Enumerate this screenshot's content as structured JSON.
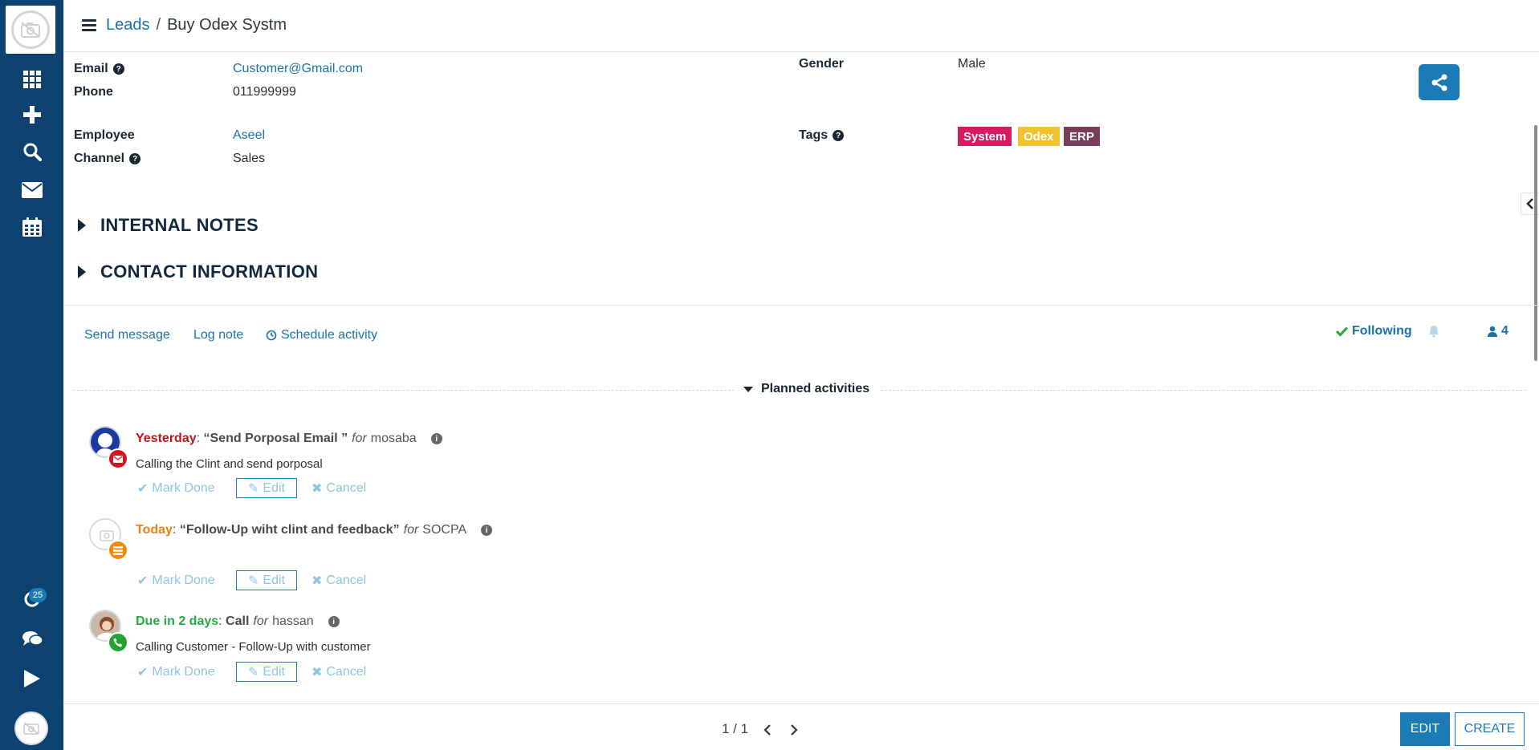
{
  "breadcrumb": {
    "parent": "Leads",
    "separator": "/",
    "current": "Buy Odex Systm"
  },
  "sidebar": {
    "items": [
      {
        "icon": "apps-grid-icon"
      },
      {
        "icon": "plus-icon"
      },
      {
        "icon": "search-icon"
      },
      {
        "icon": "mail-icon"
      },
      {
        "icon": "calendar-icon"
      },
      {
        "icon": "refresh-icon"
      },
      {
        "icon": "chat-icon"
      },
      {
        "icon": "play-icon"
      }
    ],
    "badge_count": "25"
  },
  "fields": {
    "email_label": "Email",
    "email_value": "Customer@Gmail.com",
    "phone_label": "Phone",
    "phone_value": "011999999",
    "employee_label": "Employee",
    "employee_value": "Aseel",
    "channel_label": "Channel",
    "channel_value": "Sales",
    "gender_label": "Gender",
    "gender_value": "Male",
    "tags_label": "Tags",
    "help_glyph": "?"
  },
  "tags": [
    {
      "label": "System",
      "color": "#d81b60"
    },
    {
      "label": "Odex",
      "color": "#f2c230"
    },
    {
      "label": "ERP",
      "color": "#7a3e5a"
    }
  ],
  "sections": {
    "internal_notes": "INTERNAL NOTES",
    "contact_information": "CONTACT INFORMATION"
  },
  "chatter": {
    "send_message": "Send message",
    "log_note": "Log note",
    "schedule_activity": "Schedule activity",
    "following": "Following",
    "followers_count": "4",
    "planned_activities": "Planned activities"
  },
  "activities": [
    {
      "when": "Yesterday",
      "when_color": "#c0151a",
      "summary": "“Send Porposal Email ”",
      "for_word": "for",
      "assignee": "mosaba",
      "note": "Calling the Clint and send porposal",
      "type_icon": "envelope-icon",
      "type_color": "#d8101f"
    },
    {
      "when": "Today",
      "when_color": "#e6850e",
      "summary": "“Follow-Up wiht clint and feedback”",
      "for_word": "for",
      "assignee": "SOCPA",
      "note": "",
      "type_icon": "tasks-icon",
      "type_color": "#ef8a0f"
    },
    {
      "when": "Due in 2 days",
      "when_color": "#28a745",
      "summary": "Call",
      "for_word": "for",
      "assignee": "hassan",
      "note": "Calling Customer - Follow-Up with customer",
      "type_icon": "phone-icon",
      "type_color": "#21a32f"
    }
  ],
  "activity_buttons": {
    "mark_done": "Mark Done",
    "edit": "Edit",
    "cancel": "Cancel"
  },
  "pager": {
    "text": "1 / 1"
  },
  "footer": {
    "edit": "EDIT",
    "create": "CREATE"
  }
}
